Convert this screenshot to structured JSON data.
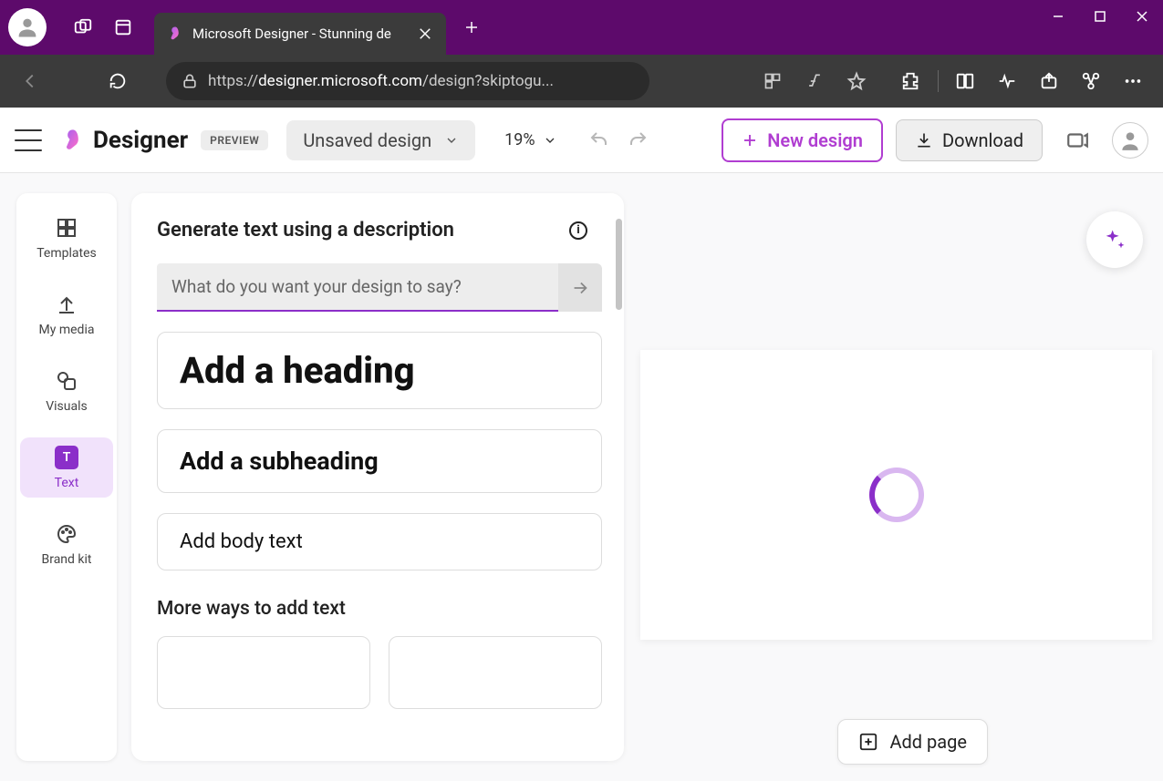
{
  "browser": {
    "tab_title": "Microsoft Designer - Stunning de",
    "url_prefix": "https://",
    "url_domain": "designer.microsoft.com",
    "url_path": "/design?skiptogu..."
  },
  "header": {
    "app_name": "Designer",
    "preview_badge": "PREVIEW",
    "design_name": "Unsaved design",
    "zoom": "19%",
    "new_design": "New design",
    "download": "Download"
  },
  "rail": {
    "items": [
      {
        "label": "Templates"
      },
      {
        "label": "My media"
      },
      {
        "label": "Visuals"
      },
      {
        "label": "Text"
      },
      {
        "label": "Brand kit"
      }
    ]
  },
  "panel": {
    "title": "Generate text using a description",
    "placeholder": "What do you want your design to say?",
    "heading_option": "Add a heading",
    "subheading_option": "Add a subheading",
    "body_option": "Add body text",
    "more_ways": "More ways to add text"
  },
  "canvas": {
    "add_page": "Add page"
  }
}
